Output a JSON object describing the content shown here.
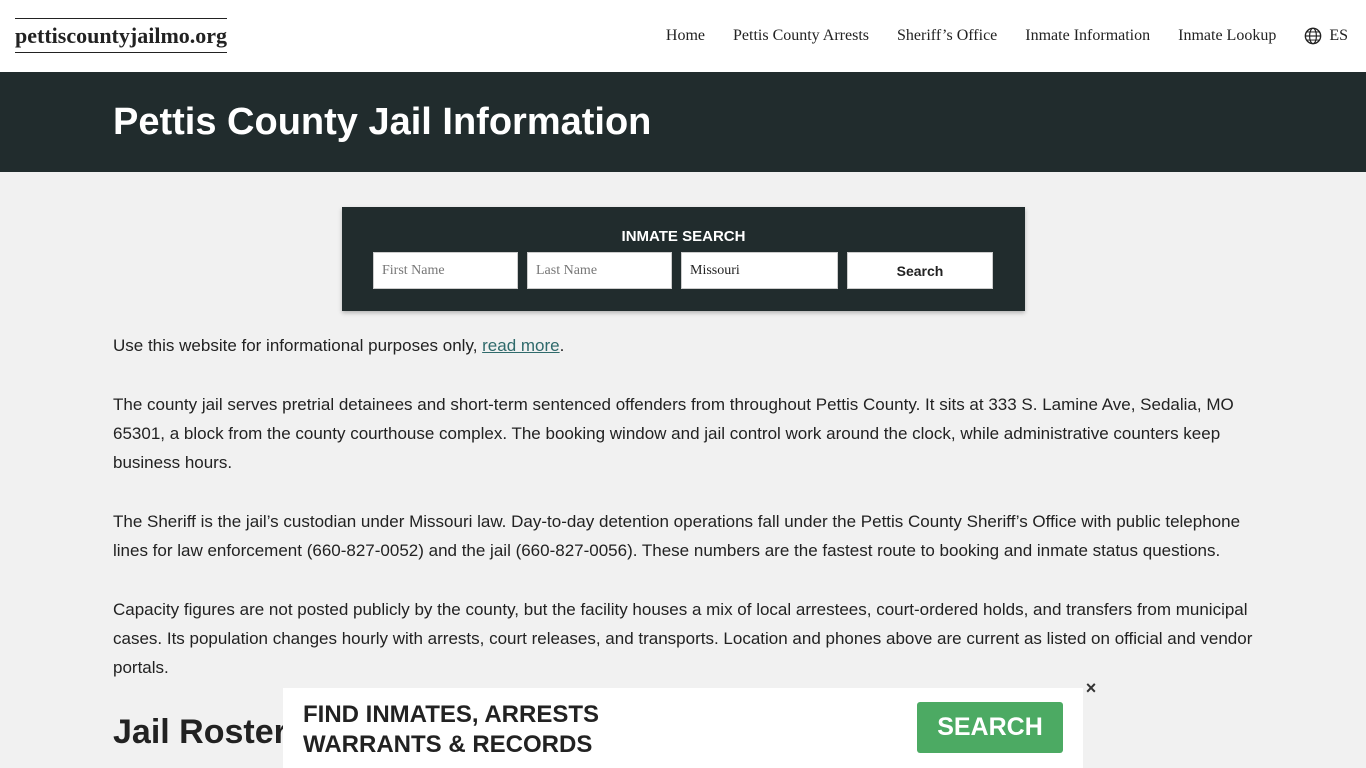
{
  "site": {
    "logo": "pettiscountyjailmo.org"
  },
  "nav": {
    "items": [
      "Home",
      "Pettis County Arrests",
      "Sheriff’s Office",
      "Inmate Information",
      "Inmate Lookup"
    ],
    "language": "ES",
    "language_icon": "globe-icon"
  },
  "hero": {
    "title": "Pettis County Jail Information"
  },
  "search": {
    "title": "INMATE SEARCH",
    "first_name_placeholder": "First Name",
    "last_name_placeholder": "Last Name",
    "state_value": "Missouri",
    "button_label": "Search"
  },
  "content": {
    "disclaimer_prefix": "Use this website for informational purposes only, ",
    "disclaimer_link": "read more",
    "disclaimer_suffix": ".",
    "paragraphs": [
      "The county jail serves pretrial detainees and short-term sentenced offenders from throughout Pettis County. It sits at 333 S. Lamine Ave, Sedalia, MO 65301, a block from the county courthouse complex. The booking window and jail control work around the clock, while administrative counters keep business hours.",
      "The Sheriff is the jail’s custodian under Missouri law. Day-to-day detention operations fall under the Pettis County Sheriff’s Office with public telephone lines for law enforcement (660-827-0052) and the jail (660-827-0056). These numbers are the fastest route to booking and inmate status questions.",
      "Capacity figures are not posted publicly by the county, but the facility houses a mix of local arrestees, court-ordered holds, and transfers from municipal cases. Its population changes hourly with arrests, court releases, and transports. Location and phones above are current as listed on official and vendor portals."
    ],
    "section_heading": "Jail Roster"
  },
  "ad": {
    "line1": "FIND INMATES, ARRESTS",
    "line2": "WARRANTS & RECORDS",
    "button_label": "SEARCH",
    "close_label": "×",
    "button_color": "#4caa63"
  },
  "colors": {
    "header_band": "#212c2d",
    "page_background": "#f1f1f1",
    "link": "#2f6a6b"
  }
}
